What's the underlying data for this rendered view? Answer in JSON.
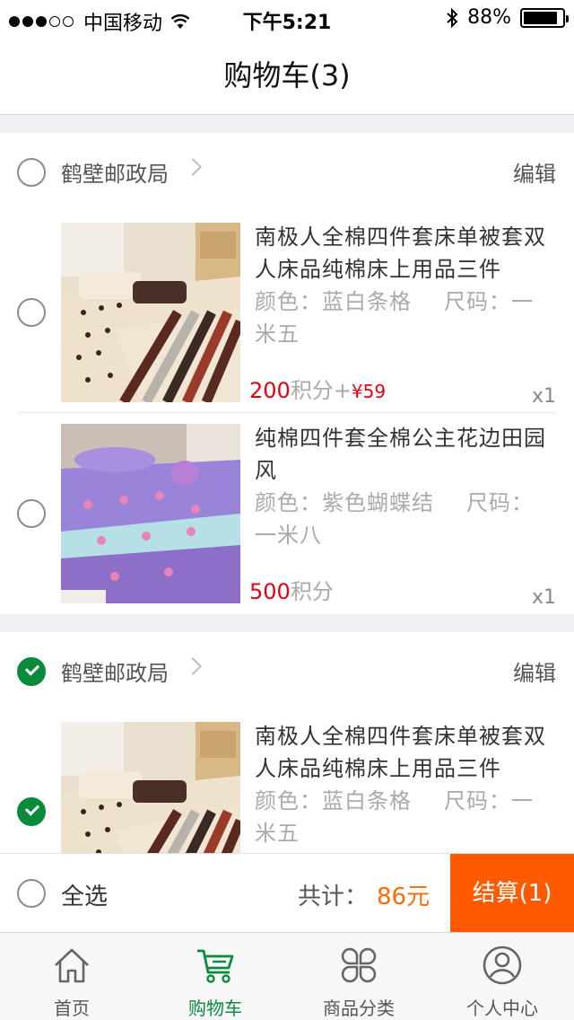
{
  "status_bar": {
    "carrier": "中国移动",
    "time": "下午5:21",
    "battery": "88%",
    "battery_level": 0.88,
    "signal_dots_filled": 3,
    "signal_dots_total": 5
  },
  "header": {
    "title": "购物车(3)"
  },
  "shops": [
    {
      "name": "鹤壁邮政局",
      "edit_label": "编辑",
      "checked": false,
      "items": [
        {
          "title": "南极人全棉四件套床单被套双人床品纯棉床上用品三件",
          "spec": "颜色：蓝白条格",
          "size": "尺码：一米五",
          "price_points": "200",
          "points_unit": "积分",
          "price_plus": "+",
          "price_currency": "¥59",
          "quantity": "x1",
          "checked": false,
          "image": "striped-bedding"
        },
        {
          "title": "纯棉四件套全棉公主花边田园风",
          "spec": "颜色：紫色蝴蝶结",
          "size": "尺码：一米八",
          "price_points": "500",
          "points_unit": "积分",
          "price_plus": "",
          "price_currency": "",
          "quantity": "x1",
          "checked": false,
          "image": "floral-bedding"
        }
      ]
    },
    {
      "name": "鹤壁邮政局",
      "edit_label": "编辑",
      "checked": true,
      "items": [
        {
          "title": "南极人全棉四件套床单被套双人床品纯棉床上用品三件",
          "spec": "颜色：蓝白条格",
          "size": "尺码：一米五",
          "price_points": "",
          "points_unit": "",
          "price_plus": "",
          "price_currency": "",
          "quantity": "",
          "checked": true,
          "image": "striped-bedding"
        }
      ]
    }
  ],
  "footer": {
    "select_all_label": "全选",
    "total_label": "共计：",
    "total_value": "86元",
    "checkout_label": "结算(1)",
    "select_all_checked": false
  },
  "tabs": [
    {
      "label": "首页",
      "icon": "home-icon",
      "active": false
    },
    {
      "label": "购物车",
      "icon": "cart-icon",
      "active": true
    },
    {
      "label": "商品分类",
      "icon": "category-icon",
      "active": false
    },
    {
      "label": "个人中心",
      "icon": "user-icon",
      "active": false
    }
  ],
  "colors": {
    "accent_green": "#0a8a3c",
    "price_red": "#e60012",
    "total_orange": "#ff6a00",
    "checkout_orange": "#ff5a00"
  }
}
